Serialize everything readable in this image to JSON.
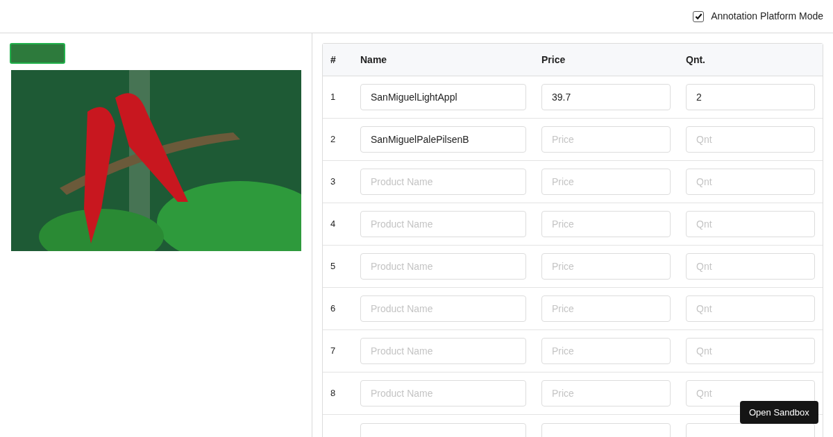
{
  "header": {
    "checkbox": {
      "label": "Annotation Platform Mode",
      "checked": true
    }
  },
  "gallery": {
    "thumbnails": [
      {
        "selected": true
      }
    ]
  },
  "table": {
    "columns": [
      "#",
      "Name",
      "Price",
      "Qnt."
    ],
    "rows": [
      {
        "number": "1",
        "name": {
          "value": "SanMiguelLightAppl"
        },
        "price": {
          "value": "39.7"
        },
        "qnt": {
          "value": "2"
        }
      },
      {
        "number": "2",
        "name": {
          "value": "SanMiguelPalePilsenB"
        },
        "price": {
          "placeholder": "Price"
        },
        "qnt": {
          "placeholder": "Qnt"
        }
      },
      {
        "number": "3",
        "name": {
          "placeholder": "Product Name"
        },
        "price": {
          "placeholder": "Price"
        },
        "qnt": {
          "placeholder": "Qnt"
        }
      },
      {
        "number": "4",
        "name": {
          "placeholder": "Product Name"
        },
        "price": {
          "placeholder": "Price"
        },
        "qnt": {
          "placeholder": "Qnt"
        }
      },
      {
        "number": "5",
        "name": {
          "placeholder": "Product Name"
        },
        "price": {
          "placeholder": "Price"
        },
        "qnt": {
          "placeholder": "Qnt"
        }
      },
      {
        "number": "6",
        "name": {
          "placeholder": "Product Name"
        },
        "price": {
          "placeholder": "Price"
        },
        "qnt": {
          "placeholder": "Qnt"
        }
      },
      {
        "number": "7",
        "name": {
          "placeholder": "Product Name"
        },
        "price": {
          "placeholder": "Price"
        },
        "qnt": {
          "placeholder": "Qnt"
        }
      },
      {
        "number": "8",
        "name": {
          "placeholder": "Product Name"
        },
        "price": {
          "placeholder": "Price"
        },
        "qnt": {
          "placeholder": "Qnt"
        }
      }
    ],
    "more_rows_below": true
  },
  "sandbox_button": "Open Sandbox"
}
